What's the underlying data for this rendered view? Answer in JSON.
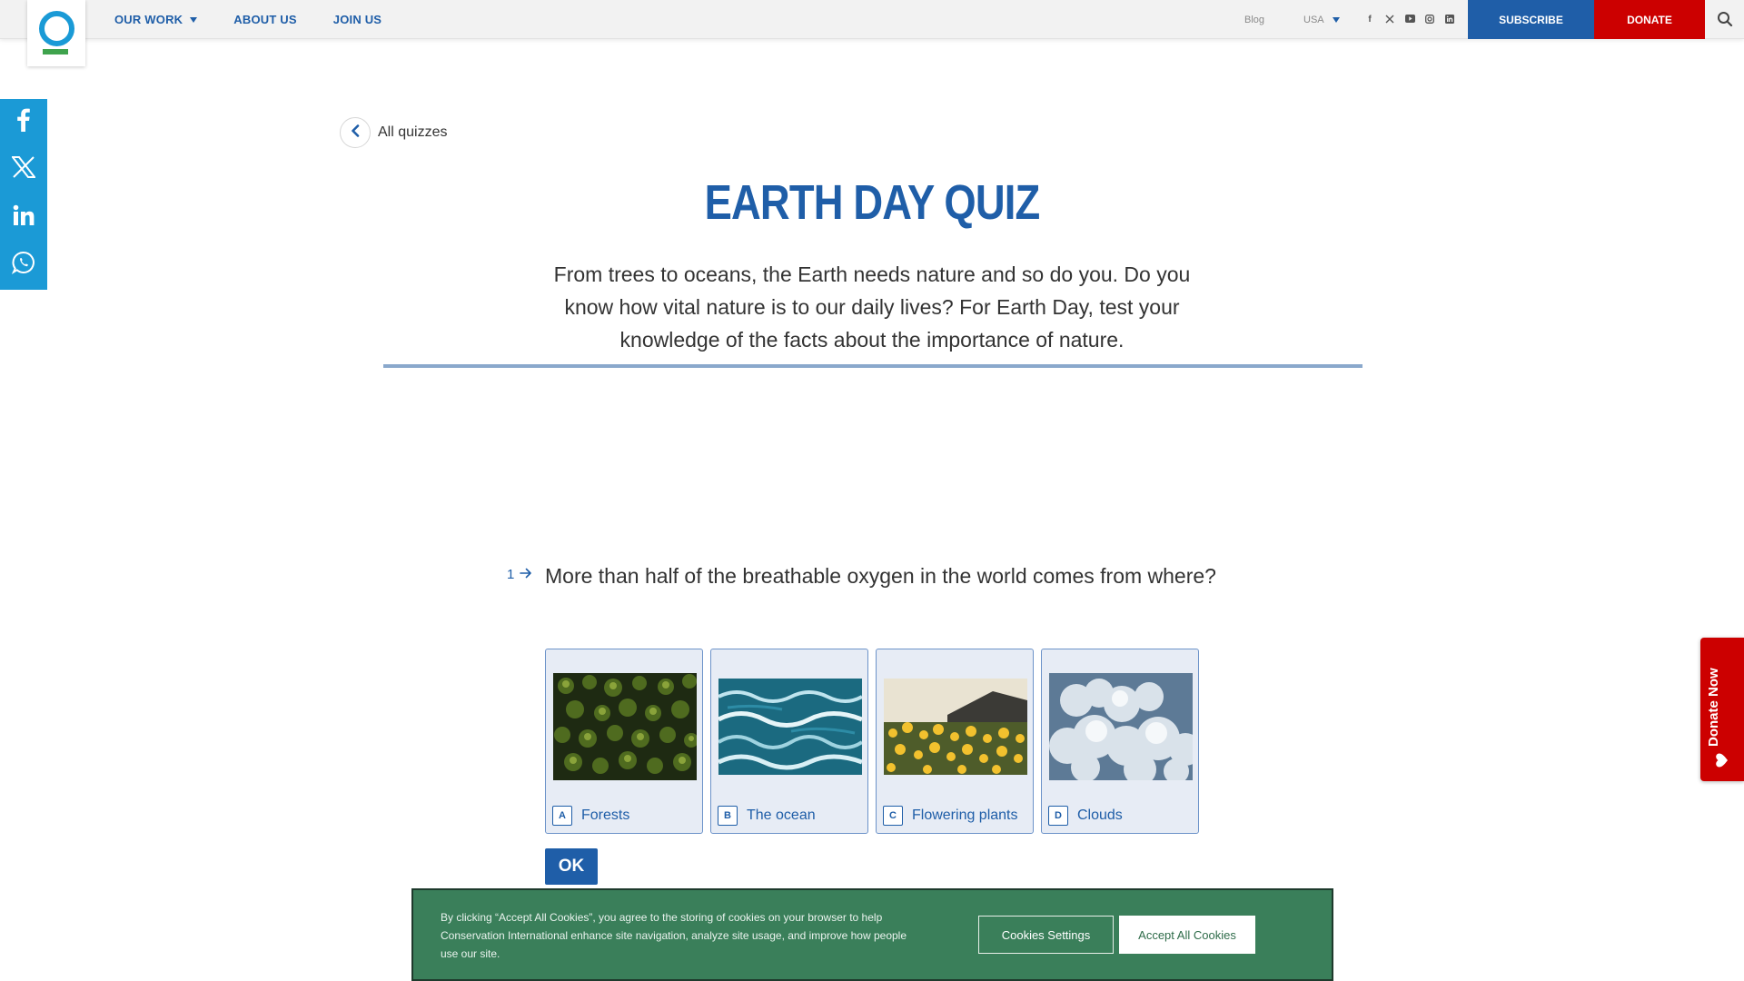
{
  "header": {
    "nav": [
      {
        "label": "OUR WORK",
        "has_dropdown": true
      },
      {
        "label": "ABOUT US",
        "has_dropdown": false
      },
      {
        "label": "JOIN US",
        "has_dropdown": false
      }
    ],
    "blog_label": "Blog",
    "region_label": "USA",
    "social_icons": [
      "facebook-icon",
      "x-icon",
      "youtube-icon",
      "instagram-icon",
      "linkedin-icon"
    ],
    "subscribe_label": "SUBSCRIBE",
    "donate_label": "DONATE"
  },
  "share_rail": [
    "facebook-icon",
    "x-icon",
    "linkedin-icon",
    "whatsapp-icon"
  ],
  "back_link": {
    "label": "All quizzes"
  },
  "page": {
    "title": "EARTH DAY QUIZ",
    "intro": "From trees to oceans, the Earth needs nature and so do you. Do you know how vital nature is to our daily lives? For Earth Day, test your knowledge of the facts about the importance of nature."
  },
  "quiz": {
    "question_number": "1",
    "question": "More than half of the breathable oxygen in the world comes from where?",
    "choices": [
      {
        "key": "A",
        "label": "Forests"
      },
      {
        "key": "B",
        "label": "The ocean"
      },
      {
        "key": "C",
        "label": "Flowering plants"
      },
      {
        "key": "D",
        "label": "Clouds"
      }
    ],
    "ok_label": "OK"
  },
  "donate_tab": {
    "label": "Donate Now"
  },
  "cookie_banner": {
    "text": "By clicking “Accept All Cookies”, you agree to the storing of cookies on your browser to help Conservation International enhance site navigation, analyze site usage, and improve how people use our site.",
    "settings_label": "Cookies Settings",
    "accept_label": "Accept All Cookies"
  },
  "colors": {
    "brand_blue": "#1f5ea8",
    "share_blue": "#1b9ad6",
    "donate_red": "#cc0000",
    "cookie_green": "#3a7f5a"
  }
}
